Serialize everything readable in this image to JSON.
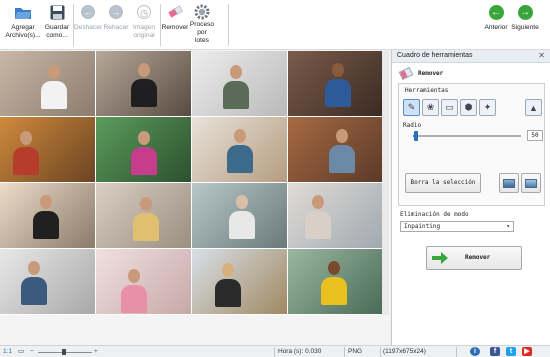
{
  "toolbar": {
    "add_files": "Agregar Archivo(s)...",
    "save_as": "Guardar como...",
    "undo": "Deshacer",
    "redo": "Rehacer",
    "original_image": "Imagen original",
    "remove": "Remover",
    "batch_process": "Proceso por lotes",
    "previous": "Anterior",
    "next": "Siguiente"
  },
  "panel": {
    "title": "Cuadro de herramientas",
    "tool_name": "Remover",
    "tools_label": "Herramientas",
    "radius_label": "Radio",
    "radius_value": "50",
    "radius_fraction": 0.03,
    "clear_selection": "Borra la selección",
    "removal_mode_label": "Eliminación de modo",
    "removal_mode_value": "Inpainting",
    "remove_button": "Remover"
  },
  "status": {
    "zoom": "1:1",
    "time": "Hora (s): 0.030",
    "format": "PNG",
    "dimensions": "(1197x675x24)"
  },
  "colors": {
    "accent": "#3aa53a",
    "selection_blue": "#3c7fc7"
  }
}
